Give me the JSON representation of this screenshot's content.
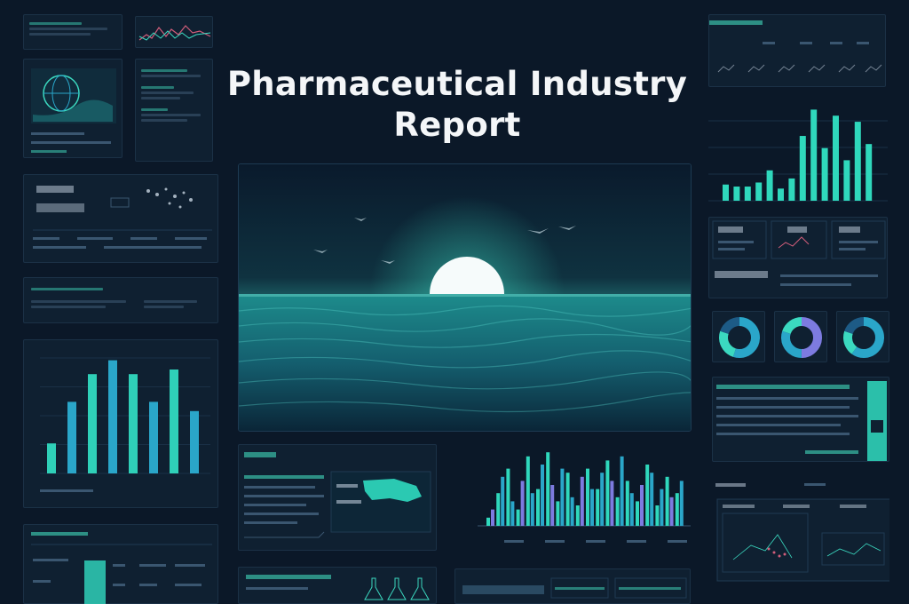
{
  "title": "Pharmaceutical Industry Report",
  "colors": {
    "background": "#0b1828",
    "panel": "#0f2031",
    "accent": "#3bd9c0",
    "accent_blue": "#2aa6c9",
    "accent_purple": "#7d7be0",
    "title": "#f4f6f8"
  },
  "hero": {
    "type": "illustration",
    "scene": "glowing sun setting over teal ocean with birds"
  },
  "charts": {
    "left_bar": {
      "values": [
        26,
        62,
        86,
        98,
        86,
        62,
        90,
        54
      ]
    },
    "right_bar": {
      "values": [
        16,
        14,
        14,
        18,
        30,
        12,
        22,
        64,
        90,
        52,
        84,
        40,
        78,
        56
      ]
    },
    "bottom_bar": {
      "values_teal": [
        10,
        40,
        70,
        20,
        85,
        45,
        90,
        30,
        65,
        25,
        70,
        45,
        80,
        35,
        55,
        30,
        75,
        25,
        60,
        40
      ],
      "values_blue": [
        20,
        60,
        30,
        55,
        40,
        75,
        50,
        70,
        35,
        60,
        45,
        65,
        55,
        85,
        40,
        50,
        65,
        45,
        35,
        55
      ]
    },
    "donuts": [
      {
        "segments": [
          0.55,
          0.25,
          0.2
        ],
        "colors": [
          "#2aa6c9",
          "#3bd9c0",
          "#1d5b86"
        ]
      },
      {
        "segments": [
          0.5,
          0.3,
          0.2
        ],
        "colors": [
          "#7d7be0",
          "#2aa6c9",
          "#3bd9c0"
        ]
      },
      {
        "segments": [
          0.6,
          0.2,
          0.2
        ],
        "colors": [
          "#2aa6c9",
          "#3bd9c0",
          "#1d5b86"
        ]
      }
    ]
  },
  "icons": [
    "globe-icon",
    "world-map-icon",
    "flask-icon"
  ]
}
